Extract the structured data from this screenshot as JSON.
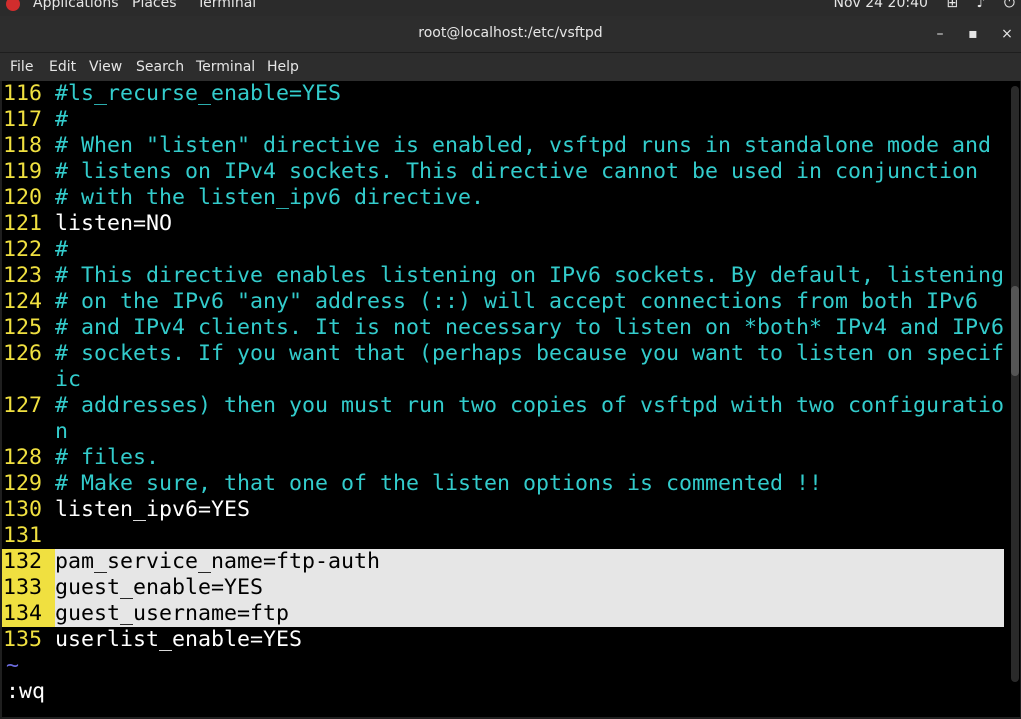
{
  "topbar": {
    "menus": [
      "Applications",
      "Places",
      "Terminal"
    ],
    "datetime": "Nov 24  20:40"
  },
  "window": {
    "title": "root@localhost:/etc/vsftpd",
    "minimize": "–",
    "maximize": "▪",
    "close": "×"
  },
  "menubar": {
    "items": [
      "File",
      "Edit",
      "View",
      "Search",
      "Terminal",
      "Help"
    ]
  },
  "editor": {
    "lines": [
      {
        "n": "116",
        "text": "#ls_recurse_enable=YES",
        "kind": "cmt"
      },
      {
        "n": "117",
        "text": "#",
        "kind": "cmt"
      },
      {
        "n": "118",
        "text": "# When \"listen\" directive is enabled, vsftpd runs in standalone mode and",
        "kind": "cmt"
      },
      {
        "n": "119",
        "text": "# listens on IPv4 sockets. This directive cannot be used in conjunction",
        "kind": "cmt"
      },
      {
        "n": "120",
        "text": "# with the listen_ipv6 directive.",
        "kind": "cmt"
      },
      {
        "n": "121",
        "text": "listen=NO",
        "kind": "code"
      },
      {
        "n": "122",
        "text": "#",
        "kind": "cmt"
      },
      {
        "n": "123",
        "text": "# This directive enables listening on IPv6 sockets. By default, listening",
        "kind": "cmt"
      },
      {
        "n": "124",
        "text": "# on the IPv6 \"any\" address (::) will accept connections from both IPv6",
        "kind": "cmt"
      },
      {
        "n": "125",
        "text": "# and IPv4 clients. It is not necessary to listen on *both* IPv4 and IPv6",
        "kind": "cmt"
      },
      {
        "n": "126",
        "text": "# sockets. If you want that (perhaps because you want to listen on specif",
        "kind": "cmt"
      },
      {
        "n": "",
        "text": "ic",
        "kind": "cmt"
      },
      {
        "n": "127",
        "text": "# addresses) then you must run two copies of vsftpd with two configuratio",
        "kind": "cmt"
      },
      {
        "n": "",
        "text": "n",
        "kind": "cmt"
      },
      {
        "n": "128",
        "text": "# files.",
        "kind": "cmt"
      },
      {
        "n": "129",
        "text": "# Make sure, that one of the listen options is commented !!",
        "kind": "cmt"
      },
      {
        "n": "130",
        "text": "listen_ipv6=YES",
        "kind": "code"
      },
      {
        "n": "131",
        "text": "",
        "kind": "code"
      },
      {
        "n": "132",
        "text": "pam_service_name=ftp-auth",
        "kind": "code",
        "selected": true
      },
      {
        "n": "133",
        "text": "guest_enable=YES",
        "kind": "code",
        "selected": true
      },
      {
        "n": "134",
        "text": "guest_username=ftp",
        "kind": "code",
        "selected": true
      },
      {
        "n": "135",
        "text": "userlist_enable=YES",
        "kind": "code"
      }
    ],
    "tilde": "~",
    "command": ":wq"
  },
  "colors": {
    "comment": "#33cccc",
    "line_number": "#f0e040",
    "selection": "#e6e6e6",
    "tilde": "#6a6adb"
  }
}
